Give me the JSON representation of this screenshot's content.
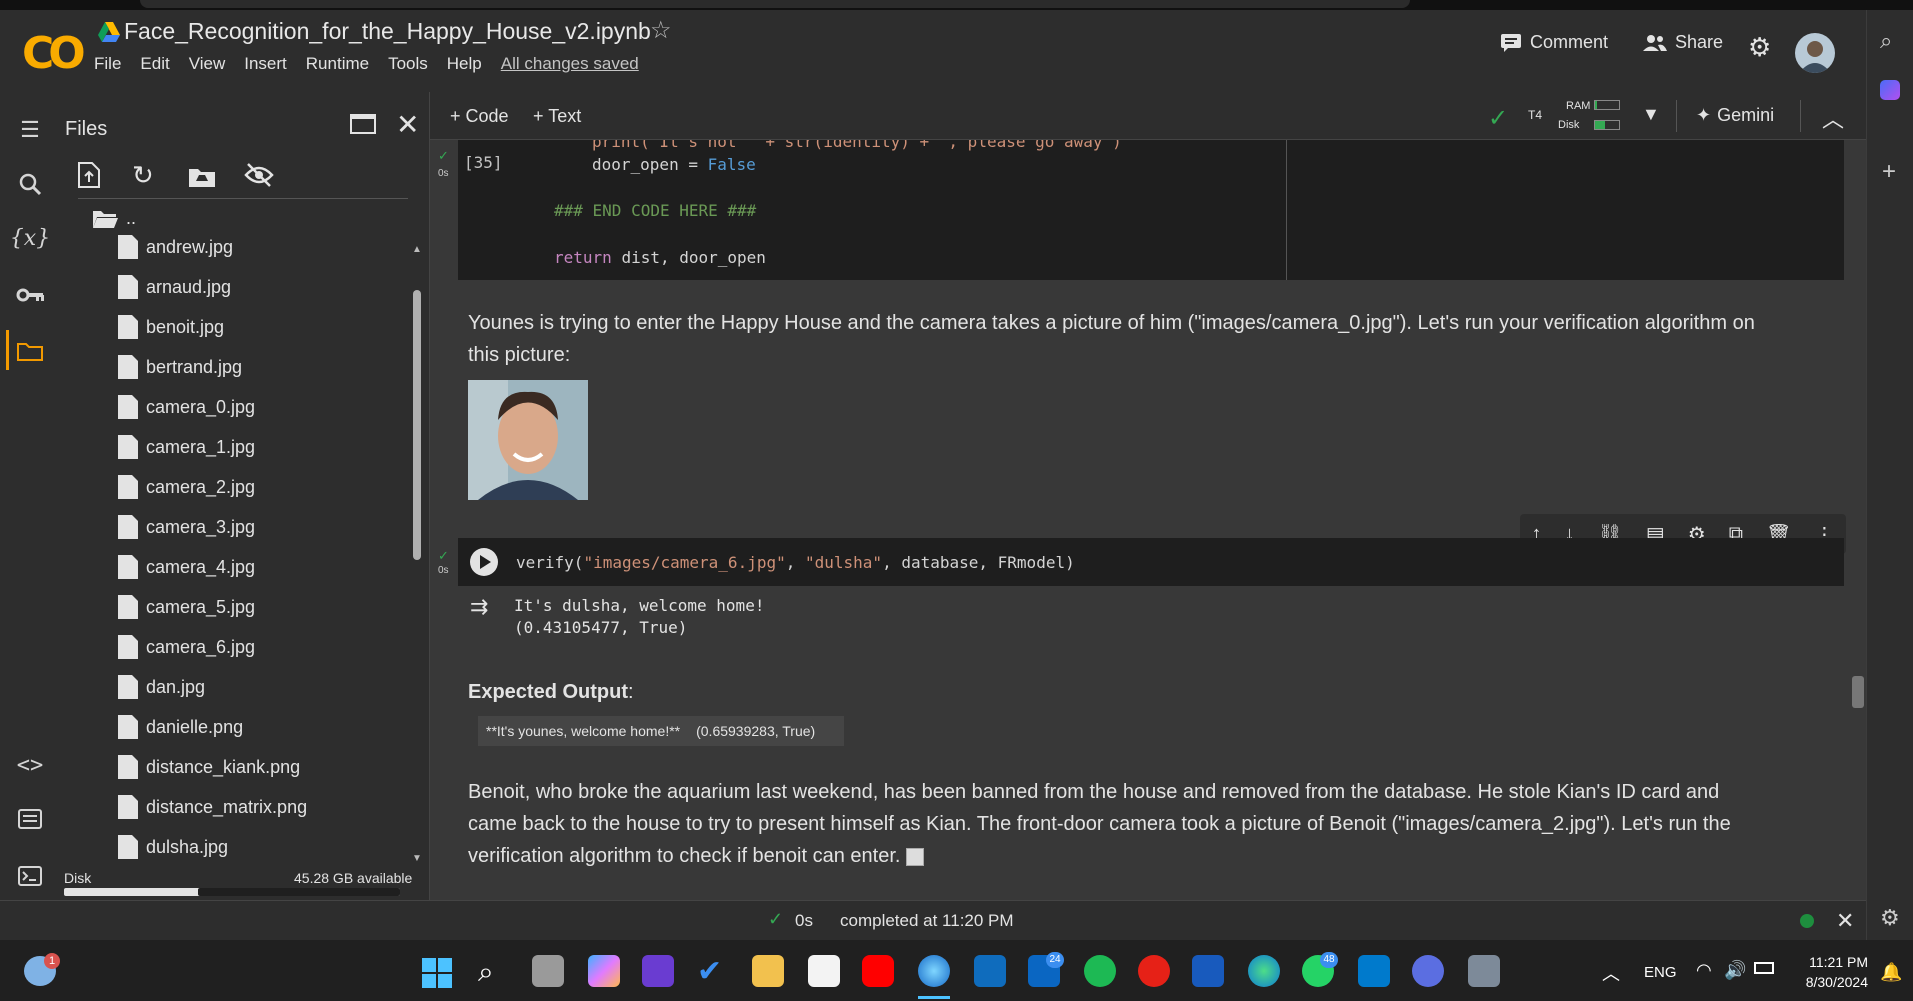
{
  "header": {
    "title": "Face_Recognition_for_the_Happy_House_v2.ipynb",
    "menu": [
      "File",
      "Edit",
      "View",
      "Insert",
      "Runtime",
      "Tools",
      "Help"
    ],
    "saved_status": "All changes saved",
    "comment_label": "Comment",
    "share_label": "Share"
  },
  "files_panel": {
    "title": "Files",
    "parent_dir": "..",
    "files": [
      "andrew.jpg",
      "arnaud.jpg",
      "benoit.jpg",
      "bertrand.jpg",
      "camera_0.jpg",
      "camera_1.jpg",
      "camera_2.jpg",
      "camera_3.jpg",
      "camera_4.jpg",
      "camera_5.jpg",
      "camera_6.jpg",
      "dan.jpg",
      "danielle.png",
      "distance_kiank.png",
      "distance_matrix.png",
      "dulsha.jpg"
    ],
    "disk_label": "Disk",
    "disk_available": "45.28 GB available",
    "disk_usage_fraction": 0.4
  },
  "toolbar": {
    "code_label": "+ Code",
    "text_label": "+ Text",
    "runtime": "T4",
    "ram_label": "RAM",
    "disk_label": "Disk",
    "gemini_label": "Gemini"
  },
  "cell1": {
    "exec_count": "[35]",
    "runtime_label": "0s",
    "lines": {
      "l0": "print(\"It's not \" + str(identity) + \", please go away\")",
      "l1a": "door_open = ",
      "l1b": "False",
      "l2": "### END CODE HERE ###",
      "l3a": "return ",
      "l3b": "dist, door_open"
    }
  },
  "md1": {
    "text": "Younes is trying to enter the Happy House and the camera takes a picture of him (\"images/camera_0.jpg\"). Let's run your verification algorithm on this picture:"
  },
  "cell2": {
    "runtime_label": "0s",
    "code_fn": "verify(",
    "code_arg1": "\"images/camera_6.jpg\"",
    "code_sep1": ", ",
    "code_arg2": "\"dulsha\"",
    "code_rest": ", database, FRmodel)",
    "output_line1": "It's dulsha, welcome home!",
    "output_line2": "(0.43105477, True)"
  },
  "expected": {
    "label": "Expected Output",
    "colon": ":",
    "cell1": "**It's younes, welcome home!**",
    "cell2": "(0.65939283, True)"
  },
  "md2": {
    "text": "Benoit, who broke the aquarium last weekend, has been banned from the house and removed from the database. He stole Kian's ID card and came back to the house to try to present himself as Kian. The front-door camera took a picture of Benoit (\"images/camera_2.jpg\"). Let's run the verification algorithm to check if benoit can enter."
  },
  "status": {
    "runtime": "0s",
    "completed": "completed at 11:20 PM"
  },
  "taskbar": {
    "lang": "ENG",
    "time": "11:21 PM",
    "date": "8/30/2024",
    "weather_badge": "1",
    "linkedin_badge": "24",
    "whatsapp_badge": "48"
  },
  "colors": {
    "accent_green": "#1e8e3e",
    "colab_orange": "#f9ab00",
    "bg_dark": "#383838"
  }
}
